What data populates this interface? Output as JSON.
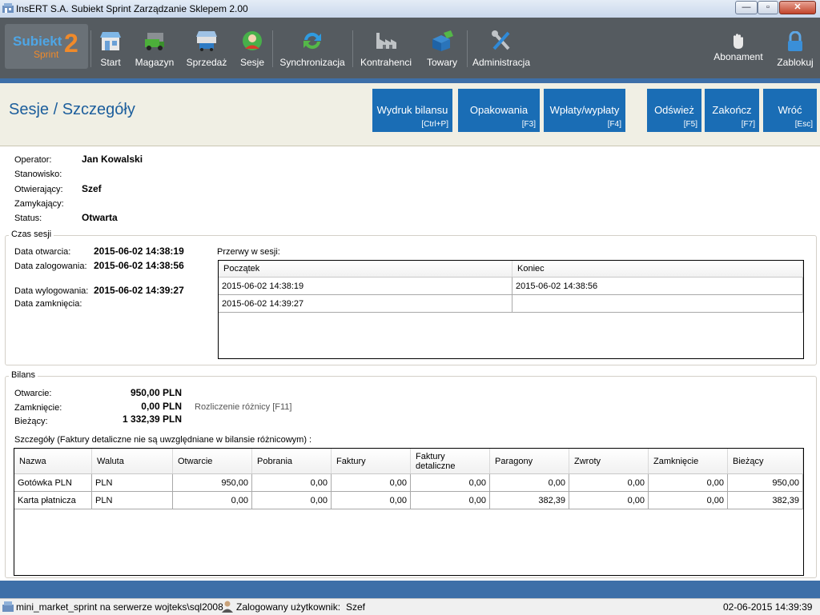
{
  "window": {
    "title": "InsERT S.A. Subiekt Sprint Zarządzanie Sklepem 2.00",
    "minimize": "—",
    "maximize": "▫",
    "close": "✕"
  },
  "logo": {
    "line1": "Subiekt",
    "line2": "Sprint",
    "digit": "2"
  },
  "toolbar": {
    "start": "Start",
    "magazyn": "Magazyn",
    "sprzedaz": "Sprzedaż",
    "sesje": "Sesje",
    "synchronizacja": "Synchronizacja",
    "kontrahenci": "Kontrahenci",
    "towary": "Towary",
    "administracja": "Administracja",
    "abonament": "Abonament",
    "zablokuj": "Zablokuj"
  },
  "header": {
    "title": "Sesje / Szczegóły",
    "buttons": [
      {
        "label": "Wydruk bilansu",
        "shortcut": "[Ctrl+P]"
      },
      {
        "label": "Opakowania",
        "shortcut": "[F3]"
      },
      {
        "label": "Wpłaty/wypłaty",
        "shortcut": "[F4]"
      },
      {
        "label": "Odśwież",
        "shortcut": "[F5]"
      },
      {
        "label": "Zakończ",
        "shortcut": "[F7]"
      },
      {
        "label": "Wróć",
        "shortcut": "[Esc]"
      }
    ]
  },
  "info": {
    "operator_label": "Operator:",
    "operator": "Jan Kowalski",
    "stanowisko_label": "Stanowisko:",
    "stanowisko": "",
    "otwierajacy_label": "Otwierający:",
    "otwierajacy": "Szef",
    "zamykajacy_label": "Zamykający:",
    "zamykajacy": "",
    "status_label": "Status:",
    "status": "Otwarta"
  },
  "czas": {
    "legend": "Czas sesji",
    "otwarcia_label": "Data otwarcia:",
    "otwarcia": "2015-06-02 14:38:19",
    "zalogowania_label": "Data zalogowania:",
    "zalogowania": "2015-06-02 14:38:56",
    "wylogowania_label": "Data wylogowania:",
    "wylogowania": "2015-06-02 14:39:27",
    "zamkniecia_label": "Data zamknięcia:",
    "zamkniecia": "",
    "przerwy_label": "Przerwy w sesji:",
    "przerwy_headers": [
      "Początek",
      "Koniec"
    ],
    "przerwy_rows": [
      [
        "2015-06-02 14:38:19",
        "2015-06-02 14:38:56"
      ],
      [
        "2015-06-02 14:39:27",
        ""
      ]
    ]
  },
  "bilans": {
    "legend": "Bilans",
    "otwarcie_label": "Otwarcie:",
    "otwarcie": "950,00 PLN",
    "zamkniecie_label": "Zamknięcie:",
    "zamkniecie": "0,00 PLN",
    "biezacy_label": "Bieżący:",
    "biezacy": "1 332,39 PLN",
    "rozliczenie": "Rozliczenie różnicy [F11]",
    "szczegoly_label": "Szczegóły (Faktury detaliczne nie są uwzględniane w bilansie różnicowym) :",
    "headers": [
      "Nazwa",
      "Waluta",
      "Otwarcie",
      "Pobrania",
      "Faktury",
      "Faktury detaliczne",
      "Paragony",
      "Zwroty",
      "Zamknięcie",
      "Bieżący"
    ],
    "rows": [
      [
        "Gotówka PLN",
        "PLN",
        "950,00",
        "0,00",
        "0,00",
        "0,00",
        "0,00",
        "0,00",
        "0,00",
        "950,00"
      ],
      [
        "Karta płatnicza",
        "PLN",
        "0,00",
        "0,00",
        "0,00",
        "0,00",
        "382,39",
        "0,00",
        "0,00",
        "382,39"
      ]
    ]
  },
  "status_bar": {
    "database": "mini_market_sprint na serwerze wojteks\\sql2008",
    "user_label": "Zalogowany użytkownik:",
    "user": "Szef",
    "datetime": "02-06-2015 14:39:39"
  },
  "colors": {
    "accent": "#1a6db5",
    "toolbar": "#555b60",
    "title_text": "#1c5e9c"
  }
}
